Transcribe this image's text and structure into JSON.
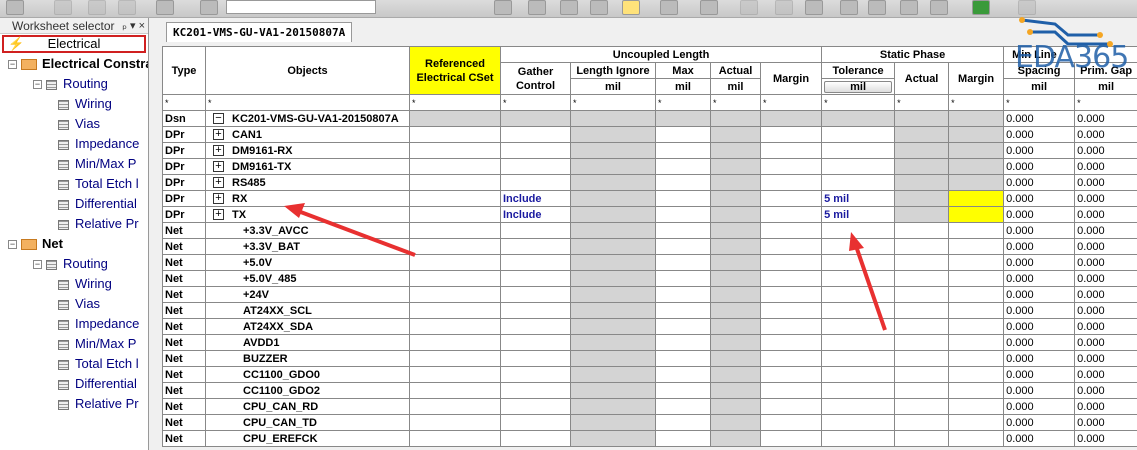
{
  "sidebar": {
    "title": "Worksheet selector",
    "pin": "ₚ ▾ ×",
    "selected": "Electrical",
    "tree": [
      {
        "label": "Electrical Constra",
        "level": 0,
        "bold": true,
        "folder": true
      },
      {
        "label": "Routing",
        "level": 1
      },
      {
        "label": "Wiring",
        "level": 2
      },
      {
        "label": "Vias",
        "level": 2
      },
      {
        "label": "Impedance",
        "level": 2
      },
      {
        "label": "Min/Max P",
        "level": 2
      },
      {
        "label": "Total Etch l",
        "level": 2
      },
      {
        "label": "Differential",
        "level": 2
      },
      {
        "label": "Relative Pr",
        "level": 2
      },
      {
        "label": "Net",
        "level": 0,
        "bold": true,
        "folder": true
      },
      {
        "label": "Routing",
        "level": 1
      },
      {
        "label": "Wiring",
        "level": 2
      },
      {
        "label": "Vias",
        "level": 2
      },
      {
        "label": "Impedance",
        "level": 2
      },
      {
        "label": "Min/Max P",
        "level": 2
      },
      {
        "label": "Total Etch l",
        "level": 2
      },
      {
        "label": "Differential",
        "level": 2
      },
      {
        "label": "Relative Pr",
        "level": 2
      }
    ]
  },
  "tab": "KC201-VMS-GU-VA1-20150807A",
  "headers": {
    "type": "Type",
    "objects": "Objects",
    "ref": "Referenced Electrical CSet",
    "uncoupled": "Uncoupled Length",
    "static": "Static Phase",
    "minline": "Min Line",
    "gather": "Gather Control",
    "lenignore": "Length Ignore",
    "max": "Max",
    "actual": "Actual",
    "margin": "Margin",
    "tolerance": "Tolerance",
    "spacing": "Spacing",
    "primgap": "Prim. Gap",
    "unit": "mil",
    "filter": "*"
  },
  "rows": [
    {
      "type": "Dsn",
      "obj": "KC201-VMS-GU-VA1-20150807A",
      "exp": "−",
      "kind": "dsn",
      "spacing": "0.000",
      "gap": "0.000"
    },
    {
      "type": "DPr",
      "obj": "CAN1",
      "exp": "+",
      "kind": "dpr",
      "spacing": "0.000",
      "gap": "0.000"
    },
    {
      "type": "DPr",
      "obj": "DM9161-RX",
      "exp": "+",
      "kind": "dpr",
      "spacing": "0.000",
      "gap": "0.000"
    },
    {
      "type": "DPr",
      "obj": "DM9161-TX",
      "exp": "+",
      "kind": "dpr",
      "spacing": "0.000",
      "gap": "0.000"
    },
    {
      "type": "DPr",
      "obj": "RS485",
      "exp": "+",
      "kind": "dpr",
      "spacing": "0.000",
      "gap": "0.000"
    },
    {
      "type": "DPr",
      "obj": "RX",
      "exp": "+",
      "kind": "dpr",
      "gather": "Include",
      "tol": "5 mil",
      "ymargin": true,
      "spacing": "0.000",
      "gap": "0.000"
    },
    {
      "type": "DPr",
      "obj": "TX",
      "exp": "+",
      "kind": "dpr",
      "gather": "Include",
      "tol": "5 mil",
      "ymargin": true,
      "spacing": "0.000",
      "gap": "0.000"
    },
    {
      "type": "Net",
      "obj": "+3.3V_AVCC",
      "kind": "net",
      "spacing": "0.000",
      "gap": "0.000"
    },
    {
      "type": "Net",
      "obj": "+3.3V_BAT",
      "kind": "net",
      "spacing": "0.000",
      "gap": "0.000"
    },
    {
      "type": "Net",
      "obj": "+5.0V",
      "kind": "net",
      "spacing": "0.000",
      "gap": "0.000"
    },
    {
      "type": "Net",
      "obj": "+5.0V_485",
      "kind": "net",
      "spacing": "0.000",
      "gap": "0.000"
    },
    {
      "type": "Net",
      "obj": "+24V",
      "kind": "net",
      "spacing": "0.000",
      "gap": "0.000"
    },
    {
      "type": "Net",
      "obj": "AT24XX_SCL",
      "kind": "net",
      "spacing": "0.000",
      "gap": "0.000"
    },
    {
      "type": "Net",
      "obj": "AT24XX_SDA",
      "kind": "net",
      "spacing": "0.000",
      "gap": "0.000"
    },
    {
      "type": "Net",
      "obj": "AVDD1",
      "kind": "net",
      "spacing": "0.000",
      "gap": "0.000"
    },
    {
      "type": "Net",
      "obj": "BUZZER",
      "kind": "net",
      "spacing": "0.000",
      "gap": "0.000"
    },
    {
      "type": "Net",
      "obj": "CC1100_GDO0",
      "kind": "net",
      "spacing": "0.000",
      "gap": "0.000"
    },
    {
      "type": "Net",
      "obj": "CC1100_GDO2",
      "kind": "net",
      "spacing": "0.000",
      "gap": "0.000"
    },
    {
      "type": "Net",
      "obj": "CPU_CAN_RD",
      "kind": "net",
      "spacing": "0.000",
      "gap": "0.000"
    },
    {
      "type": "Net",
      "obj": "CPU_CAN_TD",
      "kind": "net",
      "spacing": "0.000",
      "gap": "0.000"
    },
    {
      "type": "Net",
      "obj": "CPU_EREFCK",
      "kind": "net",
      "spacing": "0.000",
      "gap": "0.000"
    }
  ],
  "watermark": "EDA365",
  "colors": {
    "highlight": "#ffff00",
    "arrow": "#e83030",
    "selection_border": "#d02020"
  }
}
